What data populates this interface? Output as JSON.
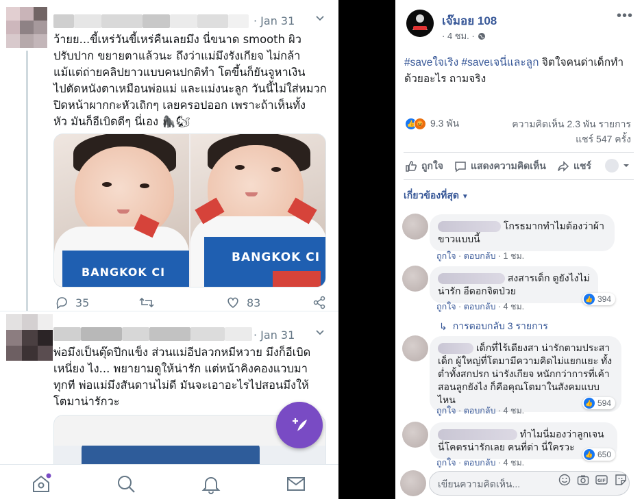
{
  "twitter": {
    "tweets": [
      {
        "date": "· Jan 31",
        "text": "ว้ายย...ขี้เหร่วันขี้เหร่คืนเลยมึง นี่ขนาด smooth ผิว\nปรับปาก ขยายตาแล้วนะ ถึงว่าแม่มึงรังเกียจ ไม่กล้า\nแม้แต่ถ่ายคลิปยาวแบบคนปกติทำ โตขึ้นก็ยันจูหาเงิน\nไปตัดหนังตาเหมือนพ่อแม่ และแม่งนะลูก วันนี้ไม่ใส่หมวก\nปิดหน้าผากกะหัวเถิกๆ เลยครอปออก เพราะถ้าเห็นทั้ง\nหัว มันก็อีเบิดดีๆ นี่เอง 🦍🐿",
        "shirt_text": "BANGKOK CI",
        "replies": "35",
        "likes": "83"
      },
      {
        "date": "· Jan 31",
        "text": "พ่อมึงเป็นตุ๊ดปีกแข็ง ส่วนแม่อีปลวกหมีหวาย มึงก็อีเบิด\nเหนี่ยง ไง... พยายามดูให้น่ารัก แต่หน้าคิงคองแวบมา\nทุกที พ่อแม่มึงสันดานไม่ดี มันจะเอาอะไรไปสอนมึงให้\nโตมาน่ารักวะ"
      }
    ],
    "nav": [
      "home-icon",
      "search-icon",
      "bell-icon",
      "mail-icon"
    ]
  },
  "facebook": {
    "page_name": "เจ๊มอย 108",
    "time": "· 4 ชม. ·",
    "post_hashtags": "#saveใจเริง #saveเจนี่และลูก",
    "post_text": " จิตใจคนด่าเด็กทำด้วยอะไร ถามจริง",
    "reaction_count": "9.3 พัน",
    "comments_count": "ความคิดเห็น 2.3 พัน รายการ",
    "shares_count": "แชร์ 547 ครั้ง",
    "actions": {
      "like": "ถูกใจ",
      "comment": "แสดงความคิดเห็น",
      "share": "แชร์"
    },
    "sort_label": "เกี่ยวข้องที่สุด",
    "comments": [
      {
        "text": "โกรธมากทำไมต้องว่าผ้าขาวแบบนี้",
        "time": "1 ชม.",
        "likes": ""
      },
      {
        "text": "สงสารเด็ก ดูยังไงไม่น่ารัก อีดอกจิตป่วย",
        "time": "4 ชม.",
        "likes": "394"
      },
      {
        "text": "เด็กที่ไร้เดียงสา น่ารักตามประสาเด็ก ผู้ใหญ่ที่โตมามีความคิดไม่แยกแยะ ทั้งต่ำทั้งสกปรก น่ารังเกียจ หนักกว่าการที่เค้าสอนลูกยังไง ก็คือคุณโตมาในสังคมแบบไหน",
        "time": "4 ชม.",
        "likes": "594"
      },
      {
        "text": "ทำไมนี่มองว่าลูกเจนนี่โคตรน่ารักเลย คนที่ด่า นี่ใครวะ",
        "time": "4 ชม.",
        "likes": "650"
      }
    ],
    "comment_like_label": "ถูกใจ",
    "comment_reply_label": "ตอบกลับ",
    "replies_link": "การตอบกลับ 3 รายการ",
    "compose_placeholder": "เขียนความคิดเห็น..."
  }
}
